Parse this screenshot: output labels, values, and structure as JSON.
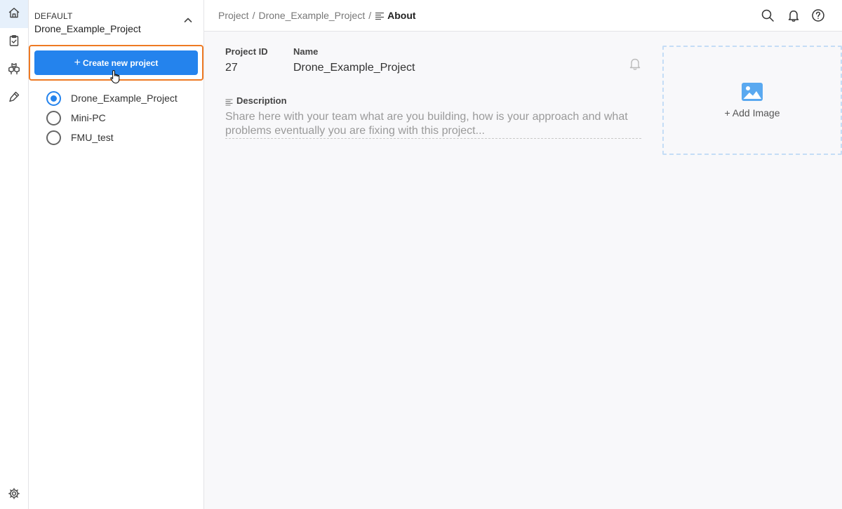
{
  "rail": {
    "items": [
      {
        "name": "home",
        "icon": "home-icon",
        "active": true
      },
      {
        "name": "tasks",
        "icon": "clipboard-check-icon",
        "active": false
      },
      {
        "name": "packages",
        "icon": "boxes-icon",
        "active": false
      },
      {
        "name": "tools",
        "icon": "pipette-icon",
        "active": false
      }
    ],
    "bottom": {
      "name": "settings",
      "icon": "gear-icon"
    }
  },
  "sidebar": {
    "group": "DEFAULT",
    "current_project": "Drone_Example_Project",
    "create_button_label": "Create new project",
    "projects": [
      {
        "label": "Drone_Example_Project",
        "selected": true
      },
      {
        "label": "Mini-PC",
        "selected": false
      },
      {
        "label": "FMU_test",
        "selected": false
      }
    ]
  },
  "topbar": {
    "breadcrumb": {
      "root": "Project",
      "separator": "/",
      "project": "Drone_Example_Project",
      "current": "About"
    },
    "icons": [
      "search-icon",
      "bell-icon",
      "help-icon"
    ]
  },
  "main": {
    "project_id_label": "Project ID",
    "project_id_value": "27",
    "name_label": "Name",
    "name_value": "Drone_Example_Project",
    "description_label": "Description",
    "description_placeholder": "Share here with your team what are you building, how is your approach and what problems eventually you are fixing with this project...",
    "add_image_label": "+ Add Image"
  },
  "colors": {
    "accent": "#2483ed",
    "highlight": "#ee7a23",
    "background": "#f8f8fa",
    "image_icon": "#5aa9f0"
  }
}
